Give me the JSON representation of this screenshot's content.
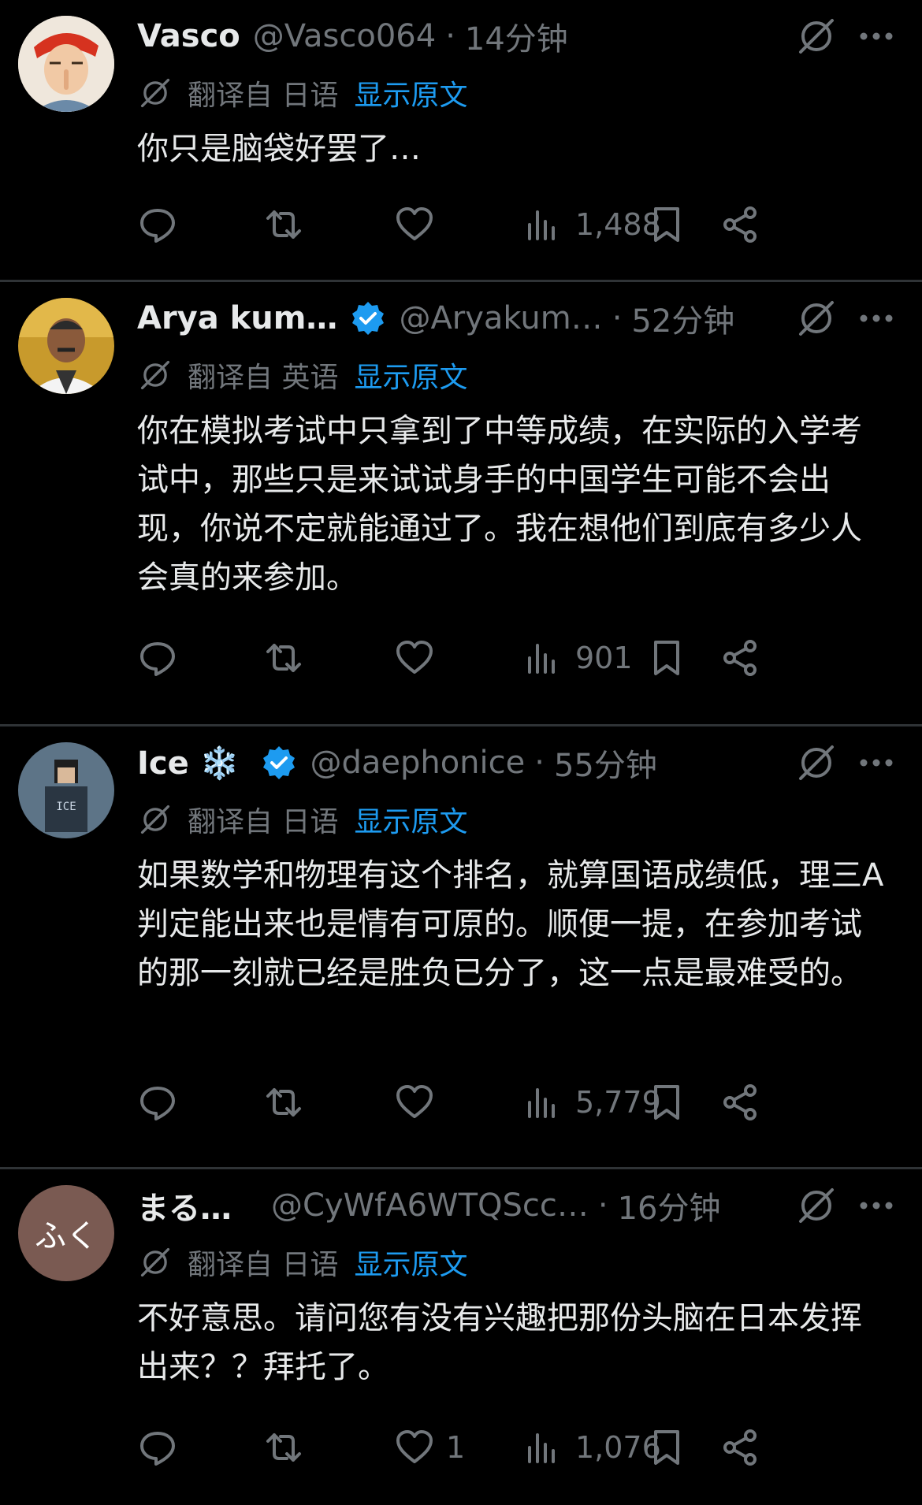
{
  "posts": [
    {
      "name": "Vasco",
      "handle": "@Vasco064",
      "time": "14分钟",
      "verified": false,
      "translate_from": "翻译自 日语",
      "show_original": "显示原文",
      "text": "你只是脑袋好罢了…",
      "likes": "",
      "views": "1,488",
      "avatar_label": ""
    },
    {
      "name": "Arya kum…",
      "handle": "@Aryakum…",
      "time": "52分钟",
      "verified": true,
      "translate_from": "翻译自 英语",
      "show_original": "显示原文",
      "text": "你在模拟考试中只拿到了中等成绩，在实际的入学考试中，那些只是来试试身手的中国学生可能不会出现，你说不定就能通过了。我在想他们到底有多少人会真的来参加。",
      "likes": "",
      "views": "901",
      "avatar_label": ""
    },
    {
      "name": "Ice ❄️",
      "handle": "@daephonice",
      "time": "55分钟",
      "verified": true,
      "translate_from": "翻译自 日语",
      "show_original": "显示原文",
      "text": "如果数学和物理有这个排名，就算国语成绩低，理三A判定能出来也是情有可原的。顺便一提，在参加考试的那一刻就已经是胜负已分了，这一点是最难受的。",
      "likes": "",
      "views": "5,779",
      "avatar_label": "ICE"
    },
    {
      "name": "まる…",
      "handle": "@CyWfA6WTQScc…",
      "time": "16分钟",
      "verified": false,
      "translate_from": "翻译自 日语",
      "show_original": "显示原文",
      "text": "不好意思。请问您有没有兴趣把那份头脑在日本发挥出来？？拜托了。",
      "likes": "1",
      "views": "1,076",
      "avatar_label": "ふく"
    }
  ],
  "colors": {
    "background": "#000000",
    "text": "#e7e9ea",
    "muted": "#71767b",
    "link": "#1d9bf0",
    "divider": "#2f3336",
    "verified": "#1d9bf0"
  },
  "icons": [
    "reply-icon",
    "retweet-icon",
    "like-icon",
    "views-icon",
    "bookmark-icon",
    "share-icon",
    "grok-icon",
    "more-icon",
    "translate-icon",
    "verified-badge-icon"
  ]
}
